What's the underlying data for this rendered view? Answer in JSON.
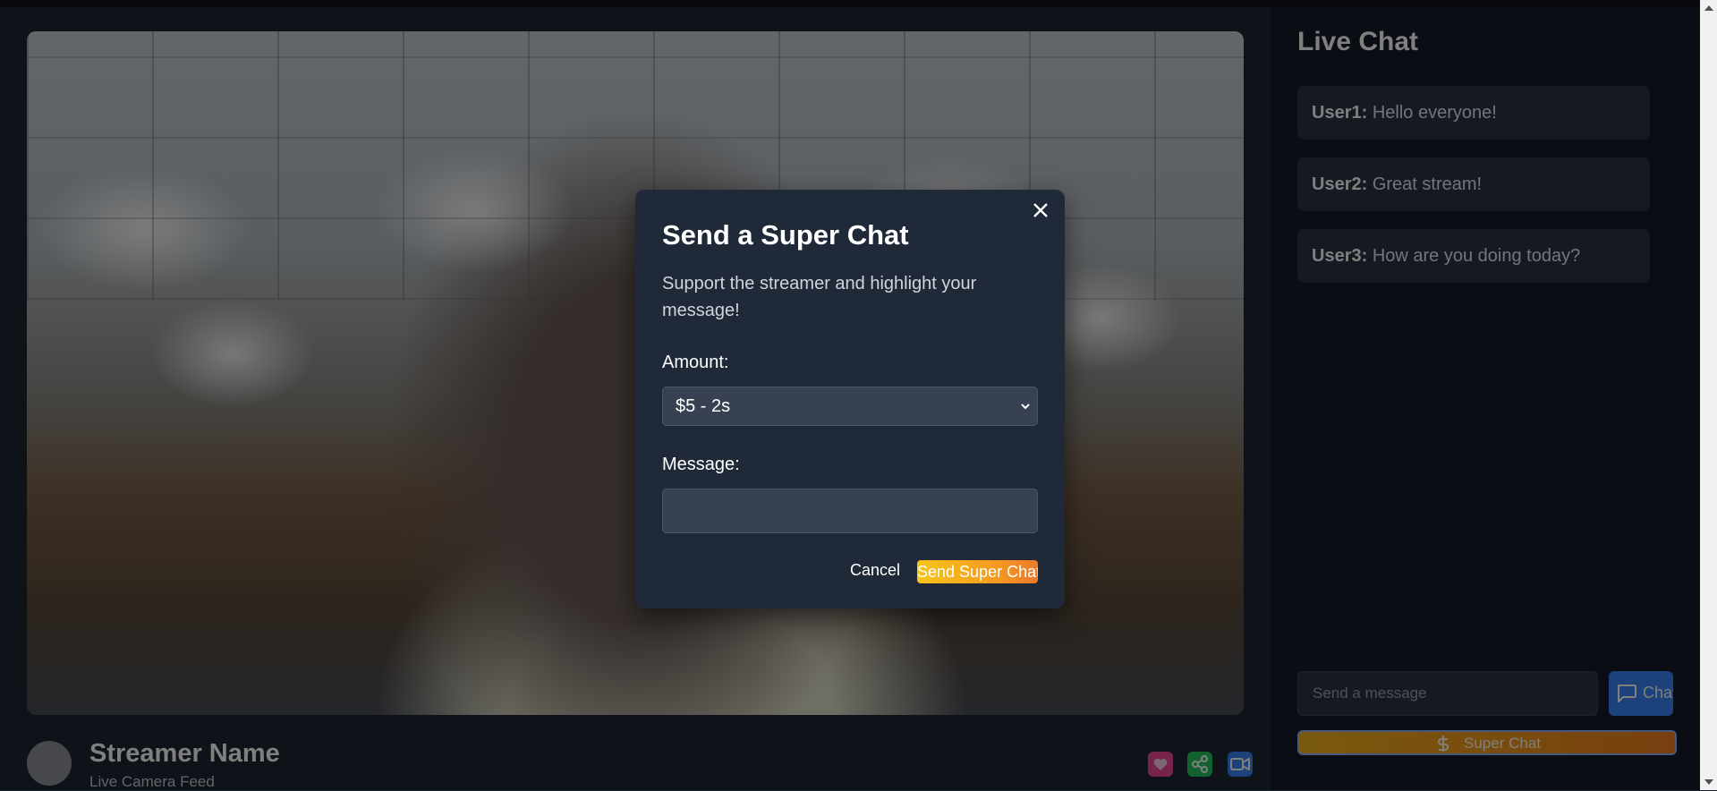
{
  "stream": {
    "streamer_name": "Streamer Name",
    "subtitle": "Live Camera Feed",
    "actions": [
      {
        "name": "heart-icon",
        "color": "#ec4899"
      },
      {
        "name": "share-icon",
        "color": "#22c55e"
      },
      {
        "name": "video-camera-icon",
        "color": "#3b82f6"
      }
    ]
  },
  "chat": {
    "title": "Live Chat",
    "messages": [
      {
        "user": "User1:",
        "text": "Hello everyone!"
      },
      {
        "user": "User2:",
        "text": "Great stream!"
      },
      {
        "user": "User3:",
        "text": "How are you doing today?"
      }
    ],
    "input_placeholder": "Send a message",
    "send_label": "Chat",
    "super_chat_label": "Super Chat"
  },
  "modal": {
    "title": "Send a Super Chat",
    "description": "Support the streamer and highlight your message!",
    "amount_label": "Amount:",
    "amount_selected": "$5 - 2s",
    "message_label": "Message:",
    "message_value": "",
    "cancel_label": "Cancel",
    "send_label": "Send Super Chat"
  },
  "colors": {
    "accent_blue": "#3b82f6",
    "super_chat_start": "#f5c51b",
    "super_chat_end": "#ee7a2a",
    "modal_bg": "#1f2937"
  }
}
